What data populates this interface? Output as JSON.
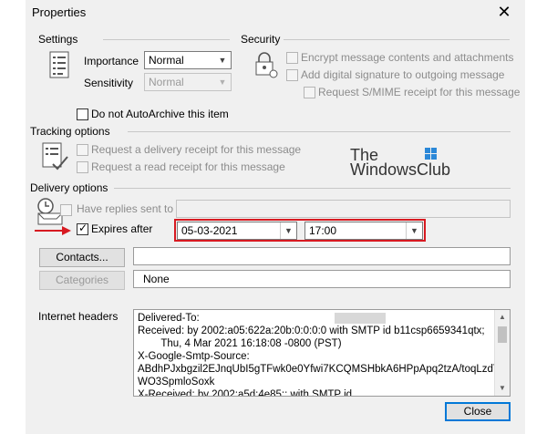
{
  "window": {
    "title": "Properties",
    "close_glyph": "✕"
  },
  "settings": {
    "label": "Settings",
    "importance_label": "Importance",
    "importance_value": "Normal",
    "sensitivity_label": "Sensitivity",
    "sensitivity_value": "Normal",
    "icon": "settings-list-icon"
  },
  "security": {
    "label": "Security",
    "icon": "padlock-settings-icon",
    "encrypt": "Encrypt message contents and attachments",
    "signature": "Add digital signature to outgoing message",
    "smime": "Request S/MIME receipt for this message"
  },
  "archive": {
    "label": "Do not AutoArchive this item"
  },
  "tracking": {
    "label": "Tracking options",
    "icon": "tracking-checklist-icon",
    "delivery_receipt": "Request a delivery receipt for this message",
    "read_receipt": "Request a read receipt for this message"
  },
  "watermark": {
    "line1": "The",
    "line2": "WindowsClub"
  },
  "delivery": {
    "label": "Delivery options",
    "icon": "clock-tray-icon",
    "replies_label": "Have replies sent to",
    "expires_label": "Expires after",
    "expires_checked": true,
    "expires_date": "05-03-2021",
    "expires_time": "17:00"
  },
  "contacts": {
    "button": "Contacts...",
    "value": ""
  },
  "categories": {
    "button": "Categories",
    "value": "None"
  },
  "headers": {
    "label": "Internet headers",
    "lines": [
      "Delivered-To:",
      "Received: by 2002:a05:622a:20b:0:0:0:0 with SMTP id b11csp6659341qtx;",
      "        Thu, 4 Mar 2021 16:18:08 -0800 (PST)",
      "X-Google-Smtp-Source:",
      "ABdhPJxbgzil2EJnqUbI5gTFwk0e0Yfwi7KCQMSHbkA6HPpApq2tzA/toqLzdTKt",
      "WO3SpmloSoxk",
      "X-Received: by 2002:a5d:4e85:: with SMTP id"
    ]
  },
  "footer": {
    "close_button": "Close"
  },
  "colors": {
    "dialog_bg": "#f0f0f0",
    "highlight": "#d71a21",
    "accent": "#0078d7"
  }
}
